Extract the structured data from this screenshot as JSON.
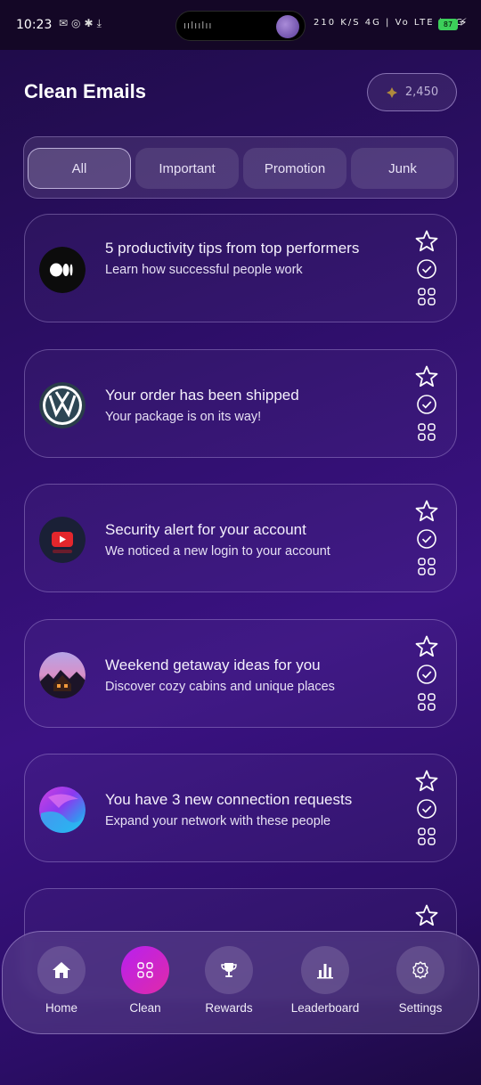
{
  "status_bar": {
    "time": "10:23",
    "left_icons": [
      "mail-icon",
      "sync-icon",
      "bug-icon",
      "download-icon"
    ],
    "net_speed": "210 K/S",
    "signal": "4G | Vo LTE | 4G",
    "battery": "87"
  },
  "header": {
    "title": "Clean Emails",
    "points": "2,450"
  },
  "tabs": [
    {
      "label": "All",
      "active": true
    },
    {
      "label": "Important",
      "active": false
    },
    {
      "label": "Promotion",
      "active": false
    },
    {
      "label": "Junk",
      "active": false
    }
  ],
  "emails": [
    {
      "title": "5 productivity tips from top performers",
      "subtitle": "Learn how successful people work",
      "logo": "medium-logo-icon"
    },
    {
      "title": "Your order has been shipped",
      "subtitle": "Your package is on its way!",
      "logo": "volkswagen-logo-icon"
    },
    {
      "title": "Security alert for your account",
      "subtitle": "We noticed a new login to your account",
      "logo": "youtube-logo-icon"
    },
    {
      "title": "Weekend getaway ideas for you",
      "subtitle": "Discover cozy cabins and unique places",
      "logo": "cabin-photo-icon"
    },
    {
      "title": "You have 3 new connection requests",
      "subtitle": "Expand your network with these people",
      "logo": "gradient-orb-icon"
    }
  ],
  "nav": [
    {
      "label": "Home",
      "icon": "home-icon",
      "active": false
    },
    {
      "label": "Clean",
      "icon": "grid-icon",
      "active": true
    },
    {
      "label": "Rewards",
      "icon": "trophy-icon",
      "active": false
    },
    {
      "label": "Leaderboard",
      "icon": "bar-chart-icon",
      "active": false
    },
    {
      "label": "Settings",
      "icon": "gear-icon",
      "active": false
    }
  ],
  "colors": {
    "background": "#2c0e66",
    "active_nav": "#c823d8",
    "battery": "#3ccf5a"
  }
}
